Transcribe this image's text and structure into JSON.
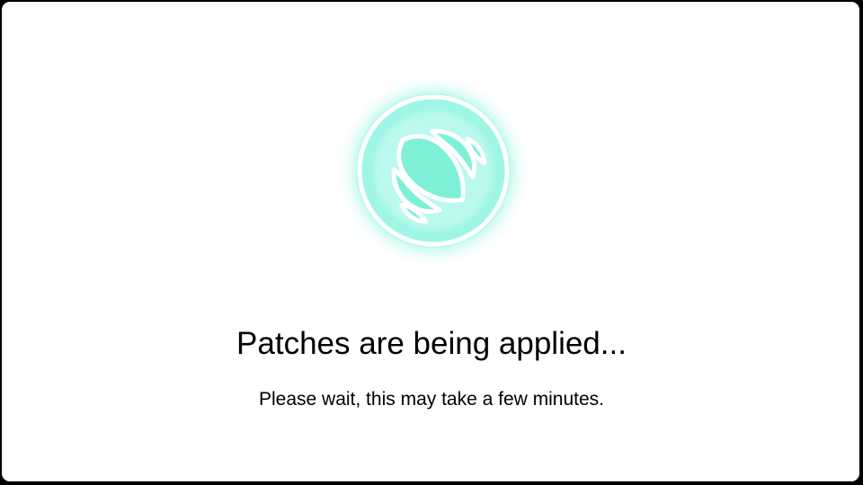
{
  "dialog": {
    "title": "Patches are being applied...",
    "subtitle": "Please wait, this may take a few minutes."
  },
  "logo": {
    "icon": "croissant-icon",
    "glow_color": "#6ff0d6",
    "stroke_color": "#ffffff"
  }
}
